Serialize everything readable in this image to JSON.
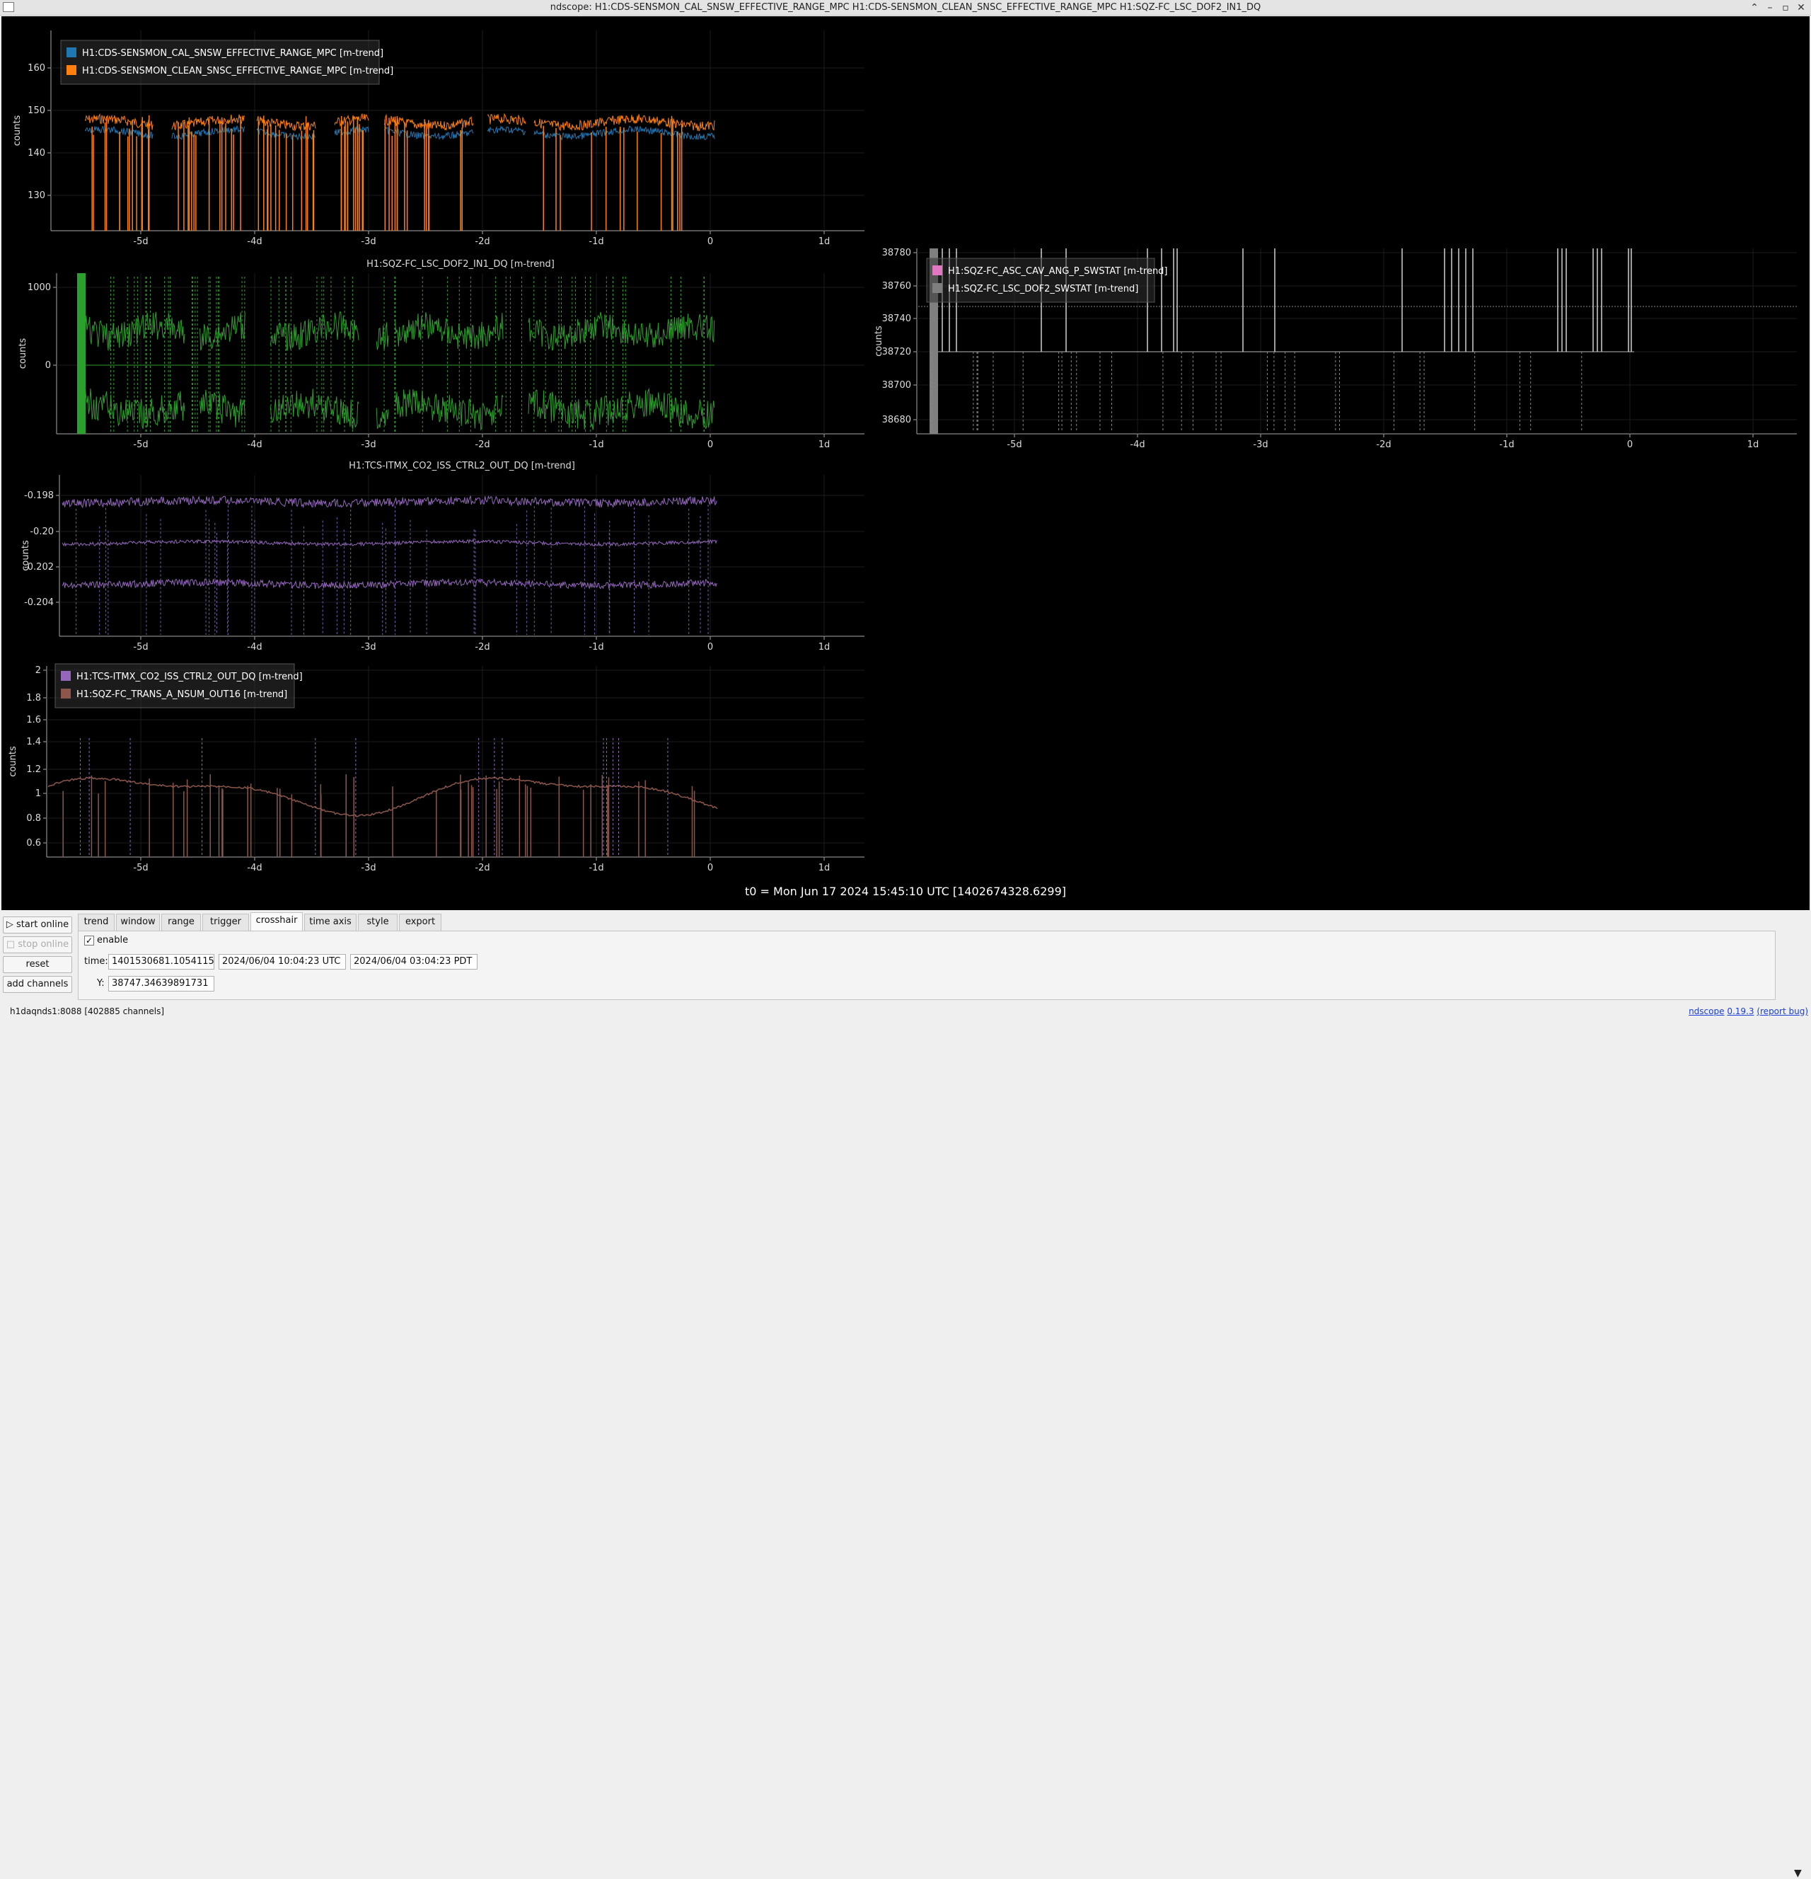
{
  "window": {
    "title": "ndscope: H1:CDS-SENSMON_CAL_SNSW_EFFECTIVE_RANGE_MPC H1:CDS-SENSMON_CLEAN_SNSC_EFFECTIVE_RANGE_MPC H1:SQZ-FC_LSC_DOF2_IN1_DQ"
  },
  "x_tick_labels": [
    "-5d",
    "-4d",
    "-3d",
    "-2d",
    "-1d",
    "0",
    "1d"
  ],
  "plots": [
    {
      "id": "range",
      "title": "",
      "ylabel": "counts",
      "yticks": [
        "160",
        "150",
        "140",
        "130"
      ],
      "legend": [
        {
          "label": "H1:CDS-SENSMON_CAL_SNSW_EFFECTIVE_RANGE_MPC [m-trend]",
          "color": "#1f77b4"
        },
        {
          "label": "H1:CDS-SENSMON_CLEAN_SNSC_EFFECTIVE_RANGE_MPC [m-trend]",
          "color": "#ff7f0e"
        }
      ]
    },
    {
      "id": "lsc",
      "title": "H1:SQZ-FC_LSC_DOF2_IN1_DQ [m-trend]",
      "ylabel": "counts",
      "yticks": [
        "1000",
        "0"
      ],
      "legend": [],
      "color": "#2ca02c"
    },
    {
      "id": "tcs",
      "title": "H1:TCS-ITMX_CO2_ISS_CTRL2_OUT_DQ [m-trend]",
      "ylabel": "counts",
      "yticks": [
        "-0.198",
        "-0.20",
        "-0.202",
        "-0.204"
      ],
      "legend": [],
      "color": "#9467bd"
    },
    {
      "id": "combo",
      "title": "",
      "ylabel": "counts",
      "yticks": [
        "2",
        "1.8",
        "1.6",
        "1.4",
        "1.2",
        "1",
        "0.8",
        "0.6"
      ],
      "legend": [
        {
          "label": "H1:TCS-ITMX_CO2_ISS_CTRL2_OUT_DQ [m-trend]",
          "color": "#9467bd"
        },
        {
          "label": "H1:SQZ-FC_TRANS_A_NSUM_OUT16 [m-trend]",
          "color": "#8c564b"
        }
      ]
    },
    {
      "id": "swstat",
      "title": "",
      "ylabel": "counts",
      "yticks": [
        "38780",
        "38760",
        "38740",
        "38720",
        "38700",
        "38680"
      ],
      "legend": [
        {
          "label": "H1:SQZ-FC_ASC_CAV_ANG_P_SWSTAT [m-trend]",
          "color": "#e377c2"
        },
        {
          "label": "H1:SQZ-FC_LSC_DOF2_SWSTAT [m-trend]",
          "color": "#7f7f7f"
        }
      ]
    }
  ],
  "t0": "t0 = Mon Jun 17 2024 15:45:10 UTC [1402674328.6299]",
  "controls": {
    "start_online": "start online",
    "stop_online": "stop online",
    "reset": "reset",
    "add_channels": "add channels",
    "tabs": [
      "trend",
      "window",
      "range",
      "trigger",
      "crosshair",
      "time axis",
      "style",
      "export"
    ],
    "active_tab": "crosshair",
    "crosshair": {
      "enable_label": "enable",
      "enabled": true,
      "check_mark": "✓",
      "time_label": "time:",
      "time_gps": "1401530681.1054115",
      "time_utc": "2024/06/04 10:04:23 UTC",
      "time_pdt": "2024/06/04 03:04:23 PDT",
      "y_label": "Y:",
      "y_value": "38747.34639891731"
    }
  },
  "status": {
    "server": "h1daqnds1:8088  [402885 channels]",
    "app_link": "ndscope",
    "version": "0.19.3",
    "report": "(report bug)"
  }
}
